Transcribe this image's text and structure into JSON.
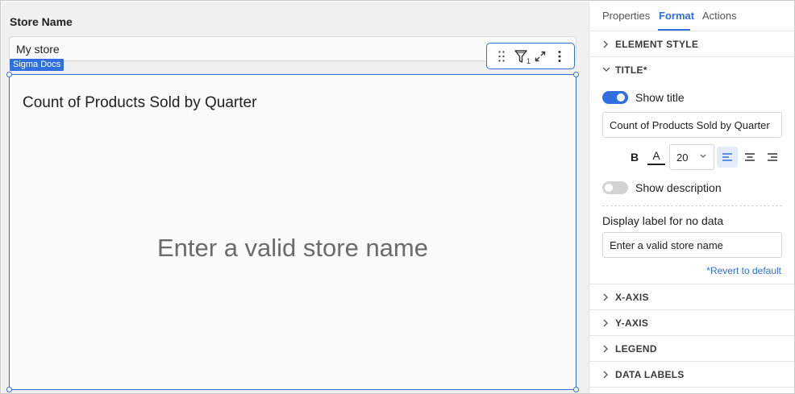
{
  "canvas": {
    "control": {
      "label": "Store Name",
      "value": "My store"
    },
    "source_tag": "Sigma Docs",
    "chart": {
      "title": "Count of Products Sold by Quarter",
      "no_data_message": "Enter a valid store name"
    },
    "toolbar": {
      "filter_count": "1",
      "icons": [
        "drag-handle-icon",
        "filter-icon",
        "expand-icon",
        "more-options-icon"
      ]
    }
  },
  "panel": {
    "tabs": [
      {
        "label": "Properties",
        "active": false
      },
      {
        "label": "Format",
        "active": true
      },
      {
        "label": "Actions",
        "active": false
      }
    ],
    "sections": {
      "element_style": "ELEMENT STYLE",
      "title": "TITLE*",
      "x_axis": "X-AXIS",
      "y_axis": "Y-AXIS",
      "legend": "LEGEND",
      "data_labels": "DATA LABELS"
    },
    "title_settings": {
      "show_title_label": "Show title",
      "show_title_on": true,
      "title_text": "Count of Products Sold by Quarter",
      "bold_label": "B",
      "color_label": "A",
      "font_size": "20",
      "alignment": "left",
      "show_description_label": "Show description",
      "show_description_on": false
    },
    "no_data": {
      "label": "Display label for no data",
      "value": "Enter a valid store name",
      "revert_link": "*Revert to default"
    }
  },
  "colors": {
    "accent": "#2f6fe0",
    "canvas_bg": "#f0f0f0",
    "element_bg": "#fafafa",
    "muted_text": "#6b6b6b"
  }
}
